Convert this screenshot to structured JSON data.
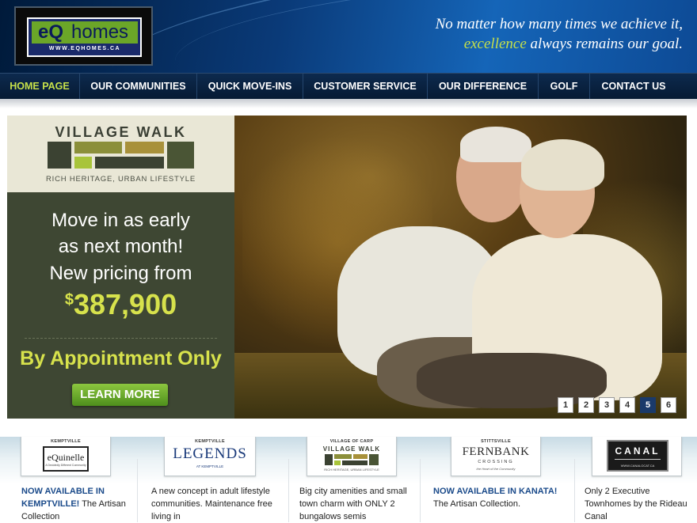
{
  "header": {
    "logo": {
      "eq": "eQ",
      "homes": "homes",
      "url": "WWW.EQHOMES.CA"
    },
    "tagline_line1": "No matter how many times we achieve it,",
    "tagline_accent": "excellence",
    "tagline_rest": " always remains our goal."
  },
  "nav": {
    "items": [
      {
        "label": "HOME PAGE",
        "active": true
      },
      {
        "label": "OUR COMMUNITIES"
      },
      {
        "label": "QUICK MOVE-INS"
      },
      {
        "label": "CUSTOMER SERVICE"
      },
      {
        "label": "OUR DIFFERENCE"
      },
      {
        "label": "GOLF"
      },
      {
        "label": "CONTACT US"
      }
    ]
  },
  "hero": {
    "promo": {
      "brand_title": "VILLAGE WALK",
      "brand_subtitle": "RICH HERITAGE, URBAN LIFESTYLE",
      "line1": "Move in as early",
      "line2": "as next month!",
      "line3": "New pricing from",
      "price_symbol": "$",
      "price": "387,900",
      "appointment": "By Appointment Only",
      "button": "LEARN MORE"
    },
    "slides": [
      "1",
      "2",
      "3",
      "4",
      "5",
      "6"
    ],
    "active_slide": "5"
  },
  "communities": [
    {
      "logo_label": "KEMPTVILLE",
      "logo_text": "eQuinelle",
      "logo_tag": "A Decidedly Different Community",
      "highlight": "NOW AVAILABLE IN KEMPTVILLE!",
      "text": " The Artisan Collection"
    },
    {
      "logo_label": "KEMPTVILLE",
      "logo_text": "LEGENDS",
      "logo_tag": "AT KEMPTVILLE",
      "highlight": "",
      "text": "A new concept in adult lifestyle communities. Maintenance free living in"
    },
    {
      "logo_label": "VILLAGE OF CARP",
      "logo_text": "VILLAGE WALK",
      "logo_tag": "RICH HERITAGE, URBAN LIFESTYLE",
      "highlight": "",
      "text": "Big city amenities and small town charm with ONLY 2 bungalows semis"
    },
    {
      "logo_label": "STITTSVILLE",
      "logo_text": "FERNBANK",
      "logo_tag": "CROSSING",
      "logo_tag2": "the Heart of the Community",
      "highlight": "NOW AVAILABLE IN KANATA!",
      "text": " The Artisan Collection."
    },
    {
      "logo_label": "",
      "logo_text": "CANAL",
      "logo_tag": "WWW.CANALOCAT.CA",
      "highlight": "",
      "text": "Only 2 Executive Townhomes by the Rideau Canal"
    }
  ],
  "colors": {
    "accent": "#c6e04a",
    "promo_bg": "#3e4733",
    "nav_bg": "#0d2a4e",
    "highlight": "#1a4a8a"
  }
}
